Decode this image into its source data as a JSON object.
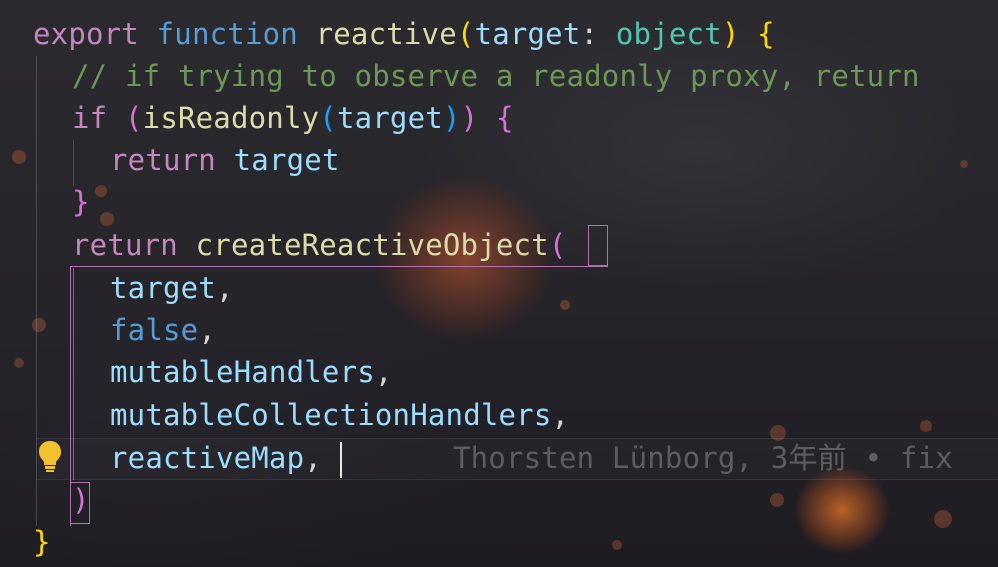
{
  "code_lines": [
    {
      "tokens": [
        {
          "t": "export",
          "c": "kw"
        },
        {
          "t": " ",
          "c": "plain"
        },
        {
          "t": "function",
          "c": "kw2"
        },
        {
          "t": " ",
          "c": "plain"
        },
        {
          "t": "reactive",
          "c": "fn"
        },
        {
          "t": "(",
          "c": "p1"
        },
        {
          "t": "target",
          "c": "var"
        },
        {
          "t": ": ",
          "c": "plain"
        },
        {
          "t": "object",
          "c": "type"
        },
        {
          "t": ")",
          "c": "p1"
        },
        {
          "t": " ",
          "c": "plain"
        },
        {
          "t": "{",
          "c": "p1"
        }
      ]
    },
    {
      "tokens": [
        {
          "t": "// if trying to observe a readonly proxy, return",
          "c": "comment"
        }
      ]
    },
    {
      "tokens": [
        {
          "t": "if",
          "c": "kw"
        },
        {
          "t": " ",
          "c": "plain"
        },
        {
          "t": "(",
          "c": "p2"
        },
        {
          "t": "isReadonly",
          "c": "fn"
        },
        {
          "t": "(",
          "c": "p3"
        },
        {
          "t": "target",
          "c": "var"
        },
        {
          "t": ")",
          "c": "p3"
        },
        {
          "t": ")",
          "c": "p2"
        },
        {
          "t": " ",
          "c": "plain"
        },
        {
          "t": "{",
          "c": "p2"
        }
      ]
    },
    {
      "tokens": [
        {
          "t": "return",
          "c": "kw"
        },
        {
          "t": " ",
          "c": "plain"
        },
        {
          "t": "target",
          "c": "var"
        }
      ]
    },
    {
      "tokens": [
        {
          "t": "}",
          "c": "p2"
        }
      ]
    },
    {
      "tokens": [
        {
          "t": "return",
          "c": "kw"
        },
        {
          "t": " ",
          "c": "plain"
        },
        {
          "t": "createReactiveObject",
          "c": "fn"
        },
        {
          "t": "(",
          "c": "p2"
        }
      ]
    },
    {
      "tokens": [
        {
          "t": "target",
          "c": "var"
        },
        {
          "t": ",",
          "c": "plain"
        }
      ]
    },
    {
      "tokens": [
        {
          "t": "false",
          "c": "bool"
        },
        {
          "t": ",",
          "c": "plain"
        }
      ]
    },
    {
      "tokens": [
        {
          "t": "mutableHandlers",
          "c": "var"
        },
        {
          "t": ",",
          "c": "plain"
        }
      ]
    },
    {
      "tokens": [
        {
          "t": "mutableCollectionHandlers",
          "c": "var"
        },
        {
          "t": ",",
          "c": "plain"
        }
      ]
    },
    {
      "tokens": [
        {
          "t": "reactiveMap",
          "c": "var"
        },
        {
          "t": ",",
          "c": "plain"
        }
      ]
    },
    {
      "tokens": [
        {
          "t": ")",
          "c": "p2"
        }
      ]
    },
    {
      "tokens": [
        {
          "t": "}",
          "c": "p1"
        }
      ]
    }
  ],
  "git_blame": "Thorsten Lünborg, 3年前 • fix",
  "icons": {
    "lightbulb": "lightbulb-icon"
  },
  "colors": {
    "keyword": "#c586c0",
    "function": "#dcdcaa",
    "variable": "#9cdcfe",
    "comment": "#6a9955",
    "bracket_gold": "#ffd700",
    "bracket_pink": "#da70d6",
    "bracket_blue": "#179fff"
  }
}
